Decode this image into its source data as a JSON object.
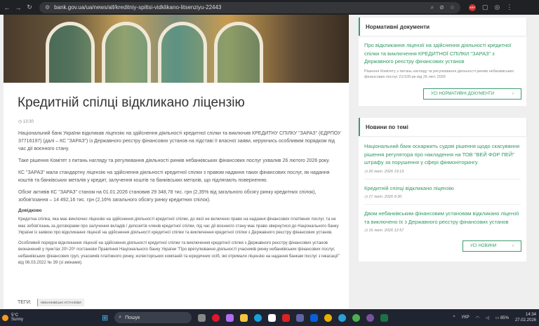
{
  "browser": {
    "url": "bank.gov.ua/ua/news/all/kreditniy-spiltsi-vidklikano-litsenziyu-22443",
    "ext_badge": "ABP"
  },
  "article": {
    "title": "Кредитній спілці відкликано ліцензію",
    "time": "13:30",
    "paragraphs": [
      "Національний банк України відкликав ліцензію на здійснення діяльності кредитної спілки та виключив КРЕДИТНУ СПІЛКУ \"ЗАРАЗ\" (ЄДРПОУ 37716197) (далі – КС \"ЗАРАЗ\") із Державного реєстру фінансових установ на підставі її власної заяви, керуючись особливим порядком під час дії воєнного стану.",
      "Таке рішення Комітет з питань нагляду та регулювання діяльності ринків небанківських фінансових послуг ухвалив 26 лютого 2026 року.",
      "КС \"ЗАРАЗ\" мала стандартну ліцензію на здійснення діяльності кредитної спілки з правом надання таких фінансових послуг, як надання коштів та банківських металів у кредит, залучення коштів та банківських металів, що підлягають поверненню.",
      "Обсяг активів КС \"ЗАРАЗ\" станом на 01.01.2026 становив 29 348,78 тис. грн (2,35% від загального обсягу ринку кредитних спілок), зобов'язання – 14 492,16 тис. грн (2,16%  загального обсягу ринку кредитних спілок)."
    ],
    "reference_title": "Довідково",
    "reference": [
      "Кредитна спілка, яка має виключно ліцензію на здійснення діяльності кредитної спілки, до якої не включено право на надання фінансових платіжних послуг, та не має зобов'язань за договорами про залучення вкладів / депозитів членів кредитної спілки, під час дії воєнного стану має право звернутися до Національного банку України із заявою про відкликання ліцензії на здійснення діяльності кредитної спілки та виключення кредитної спілки з Державного реєстру фінансових установ.",
      "Особливий порядок відкликання ліцензії на здійснення діяльності кредитної спілки та виключення кредитної спілки з Державного реєстру фінансових установ визначений у пунктах 20³-20⁹ постанови Правління Національного банку України \"Про врегулювання діяльності учасників ринку небанківських фінансових послуг, небанківських фінансових груп, учасників платіжного ринку, колекторських компаній та юридичних осіб, які отримали ліцензію на надання банкам послуг з інкасації\" від 06.03.2022 № 39 (зі змінами)."
    ],
    "tags_label": "ТЕГИ:",
    "tag": "НЕБАНКІВСЬКІ УСТАНОВИ"
  },
  "docs": {
    "title": "Нормативні документи",
    "link": "Про відкликання ліцензії на здійснення діяльності кредитної спілки та виключення КРЕДИТНОЇ СПІЛКИ \"ЗАРАЗ\" з Державного реєстру фінансових установ",
    "sub": "Рішення Комітету з питань нагляду та регулювання діяльності ринків небанківських фінансових послуг 21/105-рк від 26 лют. 2026",
    "button": "УСІ НОРМАТИВНІ ДОКУМЕНТИ"
  },
  "news": {
    "title": "Новини по темі",
    "items": [
      {
        "title": "Національний банк оскаржить судові рішення щодо скасування рішення регулятора про накладення на ТОВ \"ВЕЙ ФОР ПЕЙ\" штрафу за порушення у сфері фінмоніторингу",
        "date": "20 лют. 2026 19:13"
      },
      {
        "title": "Кредитній спілці відкликано ліцензію",
        "date": "17 лют. 2026 9:30"
      },
      {
        "title": "Двом небанківським фінансовим установам відкликано ліцензії та виключено їх з Державного реєстру фінансових установ",
        "date": "16 лют. 2026 12:57"
      }
    ],
    "button": "УСІ НОВИНИ"
  },
  "taskbar": {
    "temp": "5°C",
    "weather": "Sunny",
    "search": "Пошук",
    "lang": "УКР",
    "battery": "85%",
    "time": "14:34",
    "date": "27.02.2026"
  }
}
